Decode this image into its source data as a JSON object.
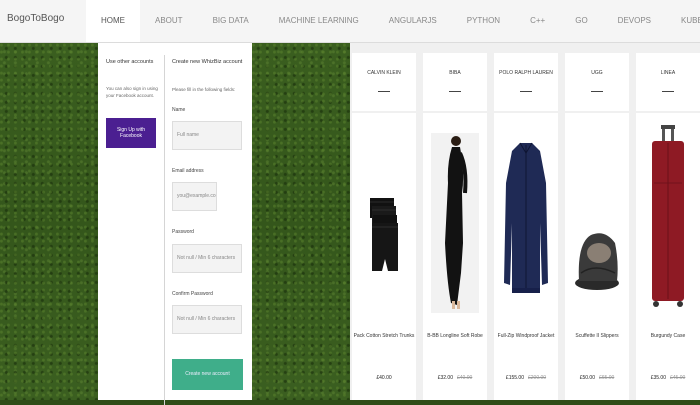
{
  "navbar": {
    "brand": "BogoToBogo",
    "items": [
      {
        "label": "HOME",
        "active": true
      },
      {
        "label": "ABOUT"
      },
      {
        "label": "BIG DATA"
      },
      {
        "label": "MACHINE LEARNING"
      },
      {
        "label": "ANGULARJS"
      },
      {
        "label": "PYTHON"
      },
      {
        "label": "C++"
      },
      {
        "label": "GO"
      },
      {
        "label": "DEVOPS"
      },
      {
        "label": "KUBERNETES"
      }
    ]
  },
  "login": {
    "social_title": "Use other accounts",
    "social_text": "You can also sign in using your Facebook account.",
    "facebook_button": "Sign Up with Facebook",
    "create_title": "Create new WhizBiz account",
    "create_text": "Please fill in the following fields:",
    "fields": [
      {
        "label": "Name",
        "placeholder": "Full name"
      },
      {
        "label": "Email address",
        "placeholder": "you@example.com"
      },
      {
        "label": "Password",
        "placeholder": "Not null / Min 6 characters"
      },
      {
        "label": "Confirm Password",
        "placeholder": "Not null / Min 6 characters"
      }
    ],
    "create_button": "Create new account"
  },
  "products": [
    {
      "brand": "CALVIN KLEIN",
      "name": "Pack Cotton Stretch Trunks",
      "price": "£40.00",
      "old_price": ""
    },
    {
      "brand": "BIBA",
      "name": "B-BB Longline Soft Robe",
      "price": "£32.00",
      "old_price": "£40.00"
    },
    {
      "brand": "POLO RALPH LAUREN",
      "name": "Full-Zip Windproof Jacket",
      "price": "£155.00",
      "old_price": "£200.00"
    },
    {
      "brand": "UGG",
      "name": "Scuffette II Slippers",
      "price": "£50.00",
      "old_price": "£65.00"
    },
    {
      "brand": "LINEA",
      "name": "Burgundy Case",
      "price": "£35.00",
      "old_price": "£45.00"
    }
  ],
  "colors": {
    "facebook": "#4b1f91",
    "create_button": "#3fae8a",
    "grass": "#34561b"
  }
}
